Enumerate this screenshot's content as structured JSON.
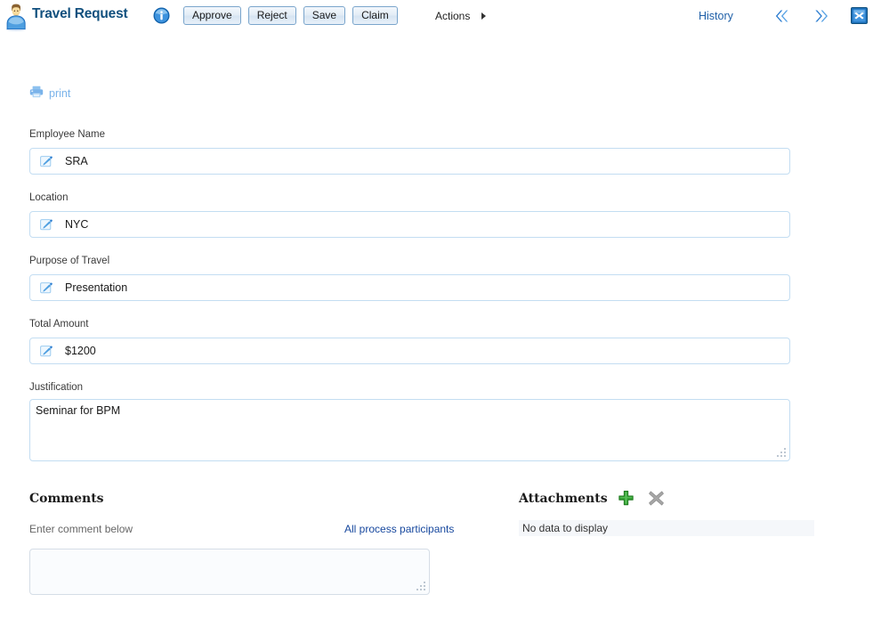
{
  "header": {
    "title": "Travel Request",
    "avatar_icon": "user-avatar-icon",
    "info_icon": "info-icon",
    "buttons": [
      {
        "label": "Approve",
        "name": "approve"
      },
      {
        "label": "Reject",
        "name": "reject"
      },
      {
        "label": "Save",
        "name": "save"
      },
      {
        "label": "Claim",
        "name": "claim"
      }
    ],
    "actions_label": "Actions",
    "history_label": "History",
    "prev_icon": "double-chevron-left-icon",
    "next_icon": "double-chevron-right-icon",
    "close_icon": "close-icon"
  },
  "toolbar": {
    "print_label": "print",
    "print_icon": "printer-icon"
  },
  "form": {
    "fields": [
      {
        "label": "Employee Name",
        "value": "SRA",
        "name": "employee-name",
        "icon": "edit-icon"
      },
      {
        "label": "Location",
        "value": "NYC",
        "name": "location",
        "icon": "edit-icon"
      },
      {
        "label": "Purpose of Travel",
        "value": "Presentation",
        "name": "purpose-of-travel",
        "icon": "edit-icon"
      },
      {
        "label": "Total Amount",
        "value": "$1200",
        "name": "total-amount",
        "icon": "edit-icon"
      }
    ],
    "justification": {
      "label": "Justification",
      "value": "Seminar for BPM"
    }
  },
  "comments": {
    "title": "Comments",
    "note": "Enter comment below",
    "participants_link": "All process participants",
    "input_value": "",
    "placeholder": ""
  },
  "attachments": {
    "title": "Attachments",
    "add_icon": "plus-icon",
    "delete_icon": "delete-x-icon",
    "empty_message": "No data to display"
  },
  "colors": {
    "title_blue": "#11507e",
    "link_blue": "#17489e",
    "print_blue": "#7ab3ea",
    "field_border": "#c3ddf2",
    "accent_green": "#3aa63a"
  }
}
